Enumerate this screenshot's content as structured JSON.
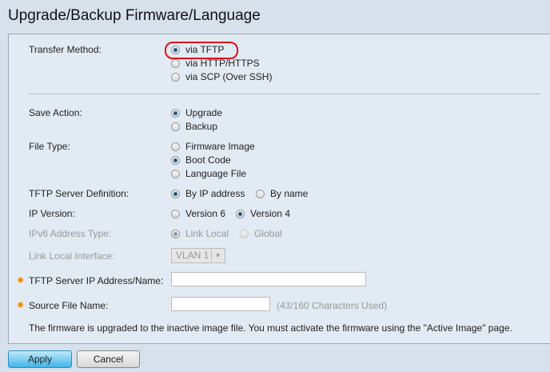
{
  "title": "Upgrade/Backup Firmware/Language",
  "transfer": {
    "label": "Transfer Method:",
    "options": [
      "via TFTP",
      "via HTTP/HTTPS",
      "via SCP (Over SSH)"
    ]
  },
  "save": {
    "label": "Save Action:",
    "options": [
      "Upgrade",
      "Backup"
    ]
  },
  "filetype": {
    "label": "File Type:",
    "options": [
      "Firmware Image",
      "Boot Code",
      "Language File"
    ]
  },
  "serverdef": {
    "label": "TFTP Server Definition:",
    "options": [
      "By IP address",
      "By name"
    ]
  },
  "ipver": {
    "label": "IP Version:",
    "options": [
      "Version 6",
      "Version 4"
    ]
  },
  "ipv6type": {
    "label": "IPv6 Address Type:",
    "options": [
      "Link Local",
      "Global"
    ]
  },
  "linklocal": {
    "label": "Link Local Interface:",
    "value": "VLAN 1"
  },
  "serverip": {
    "label": "TFTP Server IP Address/Name:",
    "value": ""
  },
  "source": {
    "label": "Source File Name:",
    "value": "",
    "counter": "(43/160 Characters Used)"
  },
  "note": "The firmware is upgraded to the inactive image file. You must activate the firmware using the \"Active Image\" page.",
  "buttons": {
    "apply": "Apply",
    "cancel": "Cancel"
  }
}
